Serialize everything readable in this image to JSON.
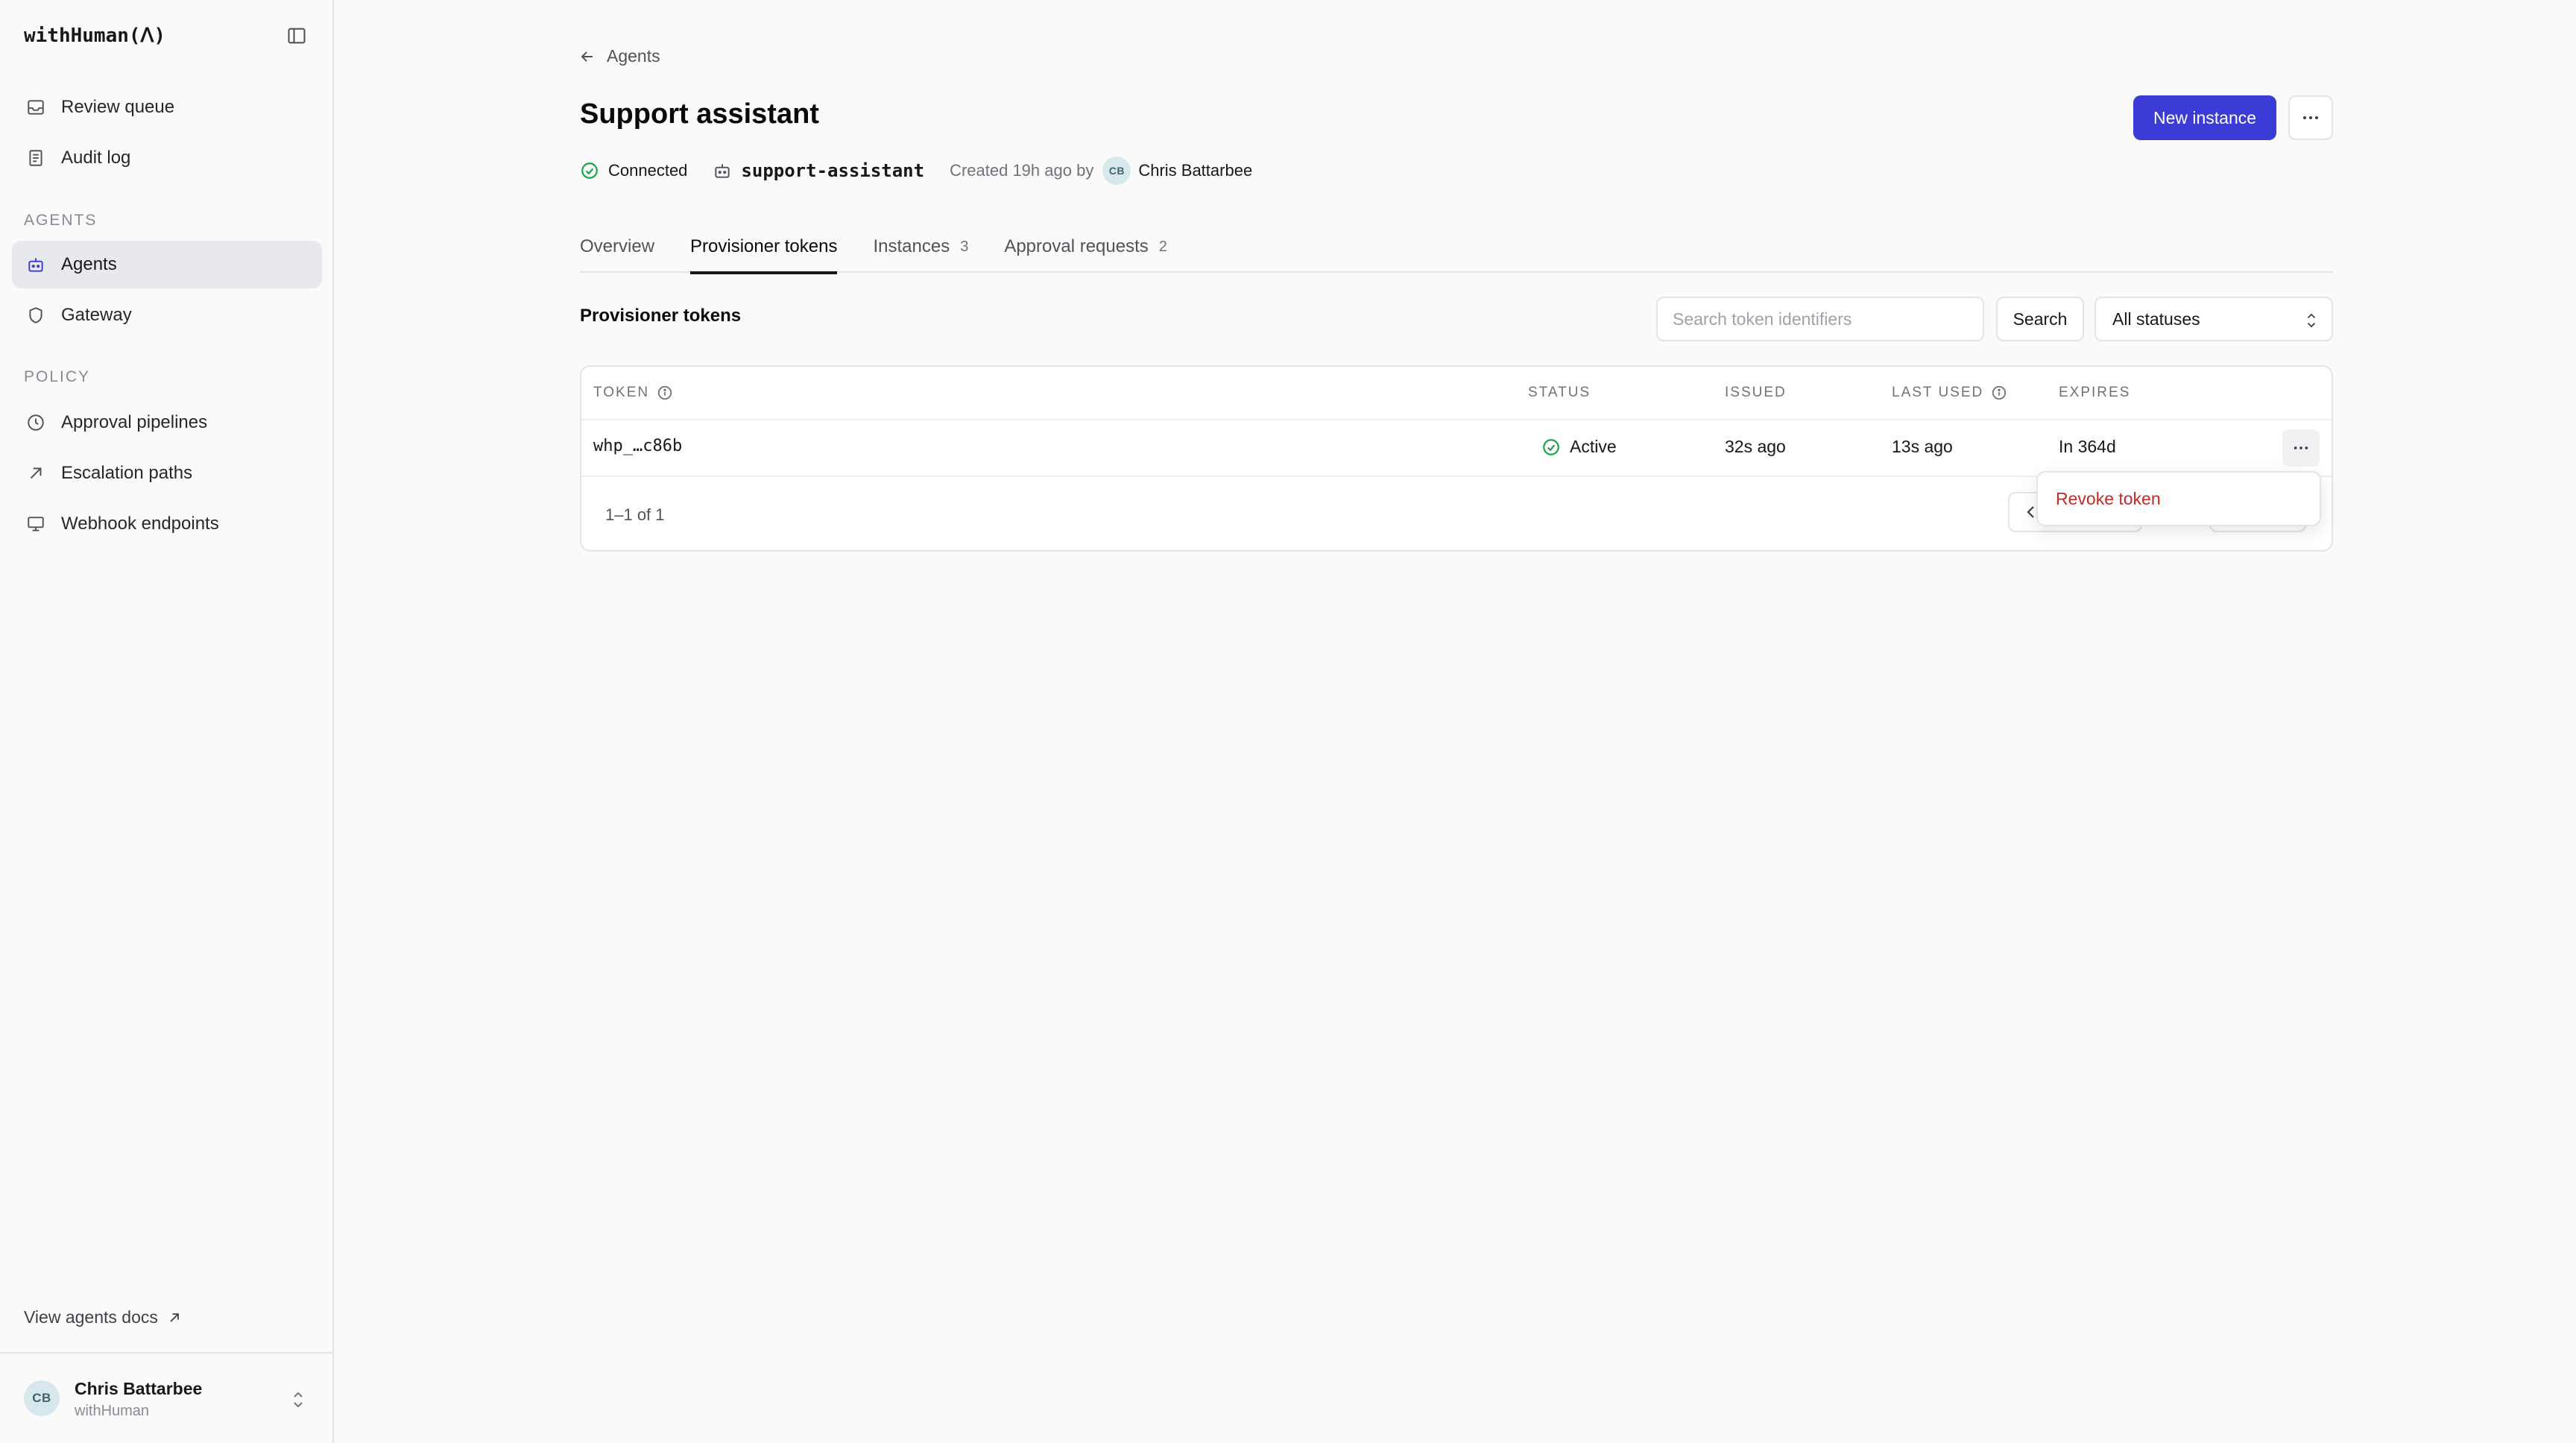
{
  "app": {
    "brand": "withHuman(ᐱ)"
  },
  "sidebar": {
    "top_items": [
      {
        "label": "Review queue",
        "icon": "inbox-icon"
      },
      {
        "label": "Audit log",
        "icon": "document-icon"
      }
    ],
    "groups": [
      {
        "label": "AGENTS",
        "items": [
          {
            "label": "Agents",
            "icon": "bot-icon",
            "active": true
          },
          {
            "label": "Gateway",
            "icon": "shield-icon"
          }
        ]
      },
      {
        "label": "POLICY",
        "items": [
          {
            "label": "Approval pipelines",
            "icon": "clock-icon"
          },
          {
            "label": "Escalation paths",
            "icon": "arrow-up-right-icon"
          },
          {
            "label": "Webhook endpoints",
            "icon": "monitor-icon"
          }
        ]
      }
    ],
    "docs_link": "View agents docs",
    "user": {
      "initials": "CB",
      "name": "Chris Battarbee",
      "org": "withHuman"
    }
  },
  "header": {
    "breadcrumb": "Agents",
    "title": "Support assistant",
    "primary_action": "New instance",
    "meta": {
      "status": "Connected",
      "slug": "support-assistant",
      "created": "Created 19h ago by",
      "creator_initials": "CB",
      "creator_name": "Chris Battarbee"
    }
  },
  "tabs": [
    {
      "label": "Overview",
      "count": ""
    },
    {
      "label": "Provisioner tokens",
      "count": "",
      "active": true
    },
    {
      "label": "Instances",
      "count": "3"
    },
    {
      "label": "Approval requests",
      "count": "2"
    }
  ],
  "tokens_section": {
    "title": "Provisioner tokens",
    "search_placeholder": "Search token identifiers",
    "search_button": "Search",
    "status_filter": "All statuses",
    "columns": {
      "token": "TOKEN",
      "status": "STATUS",
      "issued": "ISSUED",
      "last_used": "LAST USED",
      "expires": "EXPIRES"
    },
    "rows": [
      {
        "token": "whp_…c86b",
        "status": "Active",
        "issued": "32s ago",
        "last_used": "13s ago",
        "expires": "In 364d"
      }
    ],
    "pagination": "1–1 of 1",
    "row_menu": {
      "revoke": "Revoke token"
    }
  },
  "colors": {
    "accent": "#3b3bd6",
    "success": "#16a34a",
    "danger": "#c62828"
  }
}
